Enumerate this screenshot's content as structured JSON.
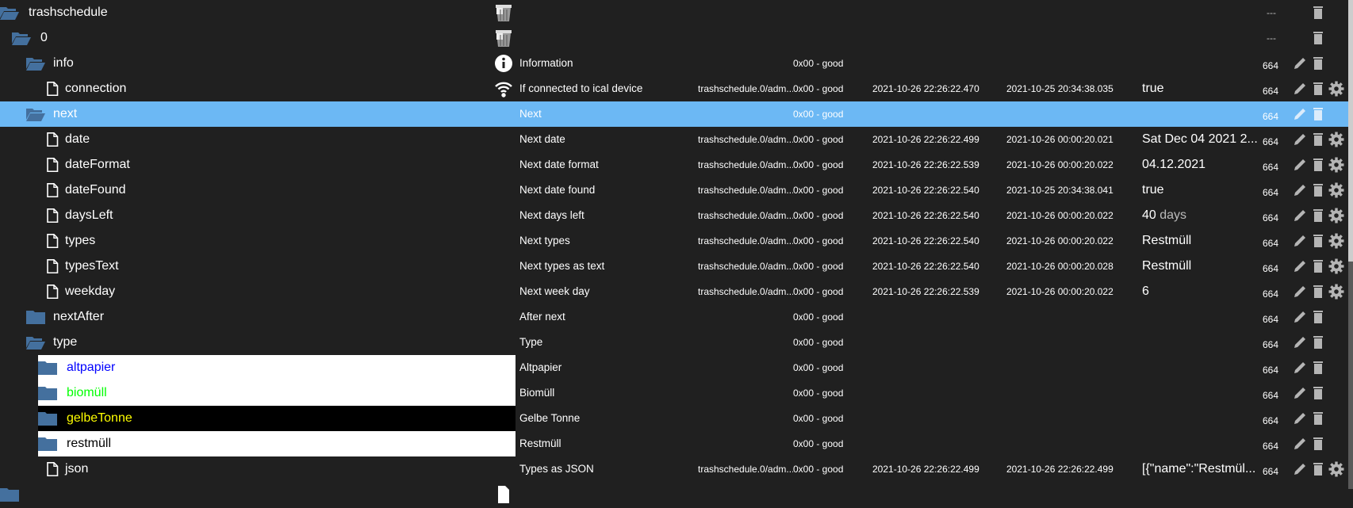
{
  "colors": {
    "background": "#202020",
    "selected": "#6cb8f4",
    "folder": "#44709e",
    "action": "#b5b5b5"
  },
  "rows": [
    {
      "name": "trashschedule",
      "level": 0,
      "type": "folder-open",
      "role_icon": "trash-bin-image",
      "desc": "",
      "oid": "",
      "quality": "",
      "ts": "",
      "lc": "",
      "value": "",
      "unit": "",
      "acl": "---",
      "actions": [
        "delete"
      ]
    },
    {
      "name": "0",
      "level": 1,
      "type": "folder-open",
      "role_icon": "trash-bin-image",
      "desc": "",
      "oid": "",
      "quality": "",
      "ts": "",
      "lc": "",
      "value": "",
      "unit": "",
      "acl": "---",
      "actions": [
        "delete"
      ]
    },
    {
      "name": "info",
      "level": 2,
      "type": "folder-open",
      "role_icon": "info-icon",
      "desc": "Information",
      "oid": "",
      "quality": "0x00 - good",
      "ts": "",
      "lc": "",
      "value": "",
      "unit": "",
      "acl": "664",
      "actions": [
        "edit",
        "delete"
      ]
    },
    {
      "name": "connection",
      "level": 3,
      "type": "file",
      "role_icon": "wifi-icon",
      "desc": "If connected to ical device",
      "oid": "trashschedule.0/adm...",
      "quality": "0x00 - good",
      "ts": "2021-10-26 22:26:22.470",
      "lc": "2021-10-25 20:34:38.035",
      "value": "true",
      "unit": "",
      "acl": "664",
      "actions": [
        "edit",
        "delete",
        "settings"
      ]
    },
    {
      "name": "next",
      "level": 2,
      "type": "folder-open",
      "role_icon": "",
      "desc": "Next",
      "oid": "",
      "quality": "0x00 - good",
      "ts": "",
      "lc": "",
      "value": "",
      "unit": "",
      "acl": "664",
      "actions": [
        "edit",
        "delete"
      ],
      "selected": true
    },
    {
      "name": "date",
      "level": 3,
      "type": "file",
      "role_icon": "",
      "desc": "Next date",
      "oid": "trashschedule.0/adm...",
      "quality": "0x00 - good",
      "ts": "2021-10-26 22:26:22.499",
      "lc": "2021-10-26 00:00:20.021",
      "value": "Sat Dec 04 2021 2...",
      "unit": "",
      "acl": "664",
      "actions": [
        "edit",
        "delete",
        "settings"
      ]
    },
    {
      "name": "dateFormat",
      "level": 3,
      "type": "file",
      "role_icon": "",
      "desc": "Next date format",
      "oid": "trashschedule.0/adm...",
      "quality": "0x00 - good",
      "ts": "2021-10-26 22:26:22.539",
      "lc": "2021-10-26 00:00:20.022",
      "value": "04.12.2021",
      "unit": "",
      "acl": "664",
      "actions": [
        "edit",
        "delete",
        "settings"
      ]
    },
    {
      "name": "dateFound",
      "level": 3,
      "type": "file",
      "role_icon": "",
      "desc": "Next date found",
      "oid": "trashschedule.0/adm...",
      "quality": "0x00 - good",
      "ts": "2021-10-26 22:26:22.540",
      "lc": "2021-10-25 20:34:38.041",
      "value": "true",
      "unit": "",
      "acl": "664",
      "actions": [
        "edit",
        "delete",
        "settings"
      ]
    },
    {
      "name": "daysLeft",
      "level": 3,
      "type": "file",
      "role_icon": "",
      "desc": "Next days left",
      "oid": "trashschedule.0/adm...",
      "quality": "0x00 - good",
      "ts": "2021-10-26 22:26:22.540",
      "lc": "2021-10-26 00:00:20.022",
      "value": "40",
      "unit": " days",
      "acl": "664",
      "actions": [
        "edit",
        "delete",
        "settings"
      ]
    },
    {
      "name": "types",
      "level": 3,
      "type": "file",
      "role_icon": "",
      "desc": "Next types",
      "oid": "trashschedule.0/adm...",
      "quality": "0x00 - good",
      "ts": "2021-10-26 22:26:22.540",
      "lc": "2021-10-26 00:00:20.022",
      "value": "Restmüll",
      "unit": "",
      "acl": "664",
      "actions": [
        "edit",
        "delete",
        "settings"
      ]
    },
    {
      "name": "typesText",
      "level": 3,
      "type": "file",
      "role_icon": "",
      "desc": "Next types as text",
      "oid": "trashschedule.0/adm...",
      "quality": "0x00 - good",
      "ts": "2021-10-26 22:26:22.540",
      "lc": "2021-10-26 00:00:20.028",
      "value": "Restmüll",
      "unit": "",
      "acl": "664",
      "actions": [
        "edit",
        "delete",
        "settings"
      ]
    },
    {
      "name": "weekday",
      "level": 3,
      "type": "file",
      "role_icon": "",
      "desc": "Next week day",
      "oid": "trashschedule.0/adm...",
      "quality": "0x00 - good",
      "ts": "2021-10-26 22:26:22.539",
      "lc": "2021-10-26 00:00:20.022",
      "value": "6",
      "unit": "",
      "acl": "664",
      "actions": [
        "edit",
        "delete",
        "settings"
      ]
    },
    {
      "name": "nextAfter",
      "level": 2,
      "type": "folder",
      "role_icon": "",
      "desc": "After next",
      "oid": "",
      "quality": "0x00 - good",
      "ts": "",
      "lc": "",
      "value": "",
      "unit": "",
      "acl": "664",
      "actions": [
        "edit",
        "delete"
      ]
    },
    {
      "name": "type",
      "level": 2,
      "type": "folder-open",
      "role_icon": "",
      "desc": "Type",
      "oid": "",
      "quality": "0x00 - good",
      "ts": "",
      "lc": "",
      "value": "",
      "unit": "",
      "acl": "664",
      "actions": [
        "edit",
        "delete"
      ]
    },
    {
      "name": "altpapier",
      "level": 4,
      "type": "folder",
      "role_icon": "",
      "desc": "Altpapier",
      "oid": "",
      "quality": "0x00 - good",
      "ts": "",
      "lc": "",
      "value": "",
      "unit": "",
      "acl": "664",
      "actions": [
        "edit",
        "delete"
      ],
      "bg": "#ffffff",
      "fg": "#0000ff"
    },
    {
      "name": "biomüll",
      "level": 4,
      "type": "folder",
      "role_icon": "",
      "desc": "Biomüll",
      "oid": "",
      "quality": "0x00 - good",
      "ts": "",
      "lc": "",
      "value": "",
      "unit": "",
      "acl": "664",
      "actions": [
        "edit",
        "delete"
      ],
      "bg": "#ffffff",
      "fg": "#00ff00"
    },
    {
      "name": "gelbeTonne",
      "level": 4,
      "type": "folder",
      "role_icon": "",
      "desc": "Gelbe Tonne",
      "oid": "",
      "quality": "0x00 - good",
      "ts": "",
      "lc": "",
      "value": "",
      "unit": "",
      "acl": "664",
      "actions": [
        "edit",
        "delete"
      ],
      "bg": "#000000",
      "fg": "#ffff00"
    },
    {
      "name": "restmüll",
      "level": 4,
      "type": "folder",
      "role_icon": "",
      "desc": "Restmüll",
      "oid": "",
      "quality": "0x00 - good",
      "ts": "",
      "lc": "",
      "value": "",
      "unit": "",
      "acl": "664",
      "actions": [
        "edit",
        "delete"
      ],
      "bg": "#ffffff",
      "fg": "#000000"
    },
    {
      "name": "json",
      "level": 3,
      "type": "file",
      "role_icon": "",
      "desc": "Types as JSON",
      "oid": "trashschedule.0/adm...",
      "quality": "0x00 - good",
      "ts": "2021-10-26 22:26:22.499",
      "lc": "2021-10-26 22:26:22.499",
      "value": "[{\"name\":\"Restmül...",
      "unit": "",
      "acl": "664",
      "actions": [
        "edit",
        "delete",
        "settings"
      ]
    },
    {
      "name": "",
      "level": 0,
      "type": "folder",
      "role_icon": "file-icon",
      "desc": "",
      "oid": "",
      "quality": "",
      "ts": "",
      "lc": "",
      "value": "",
      "unit": "",
      "acl": "",
      "actions": []
    }
  ]
}
